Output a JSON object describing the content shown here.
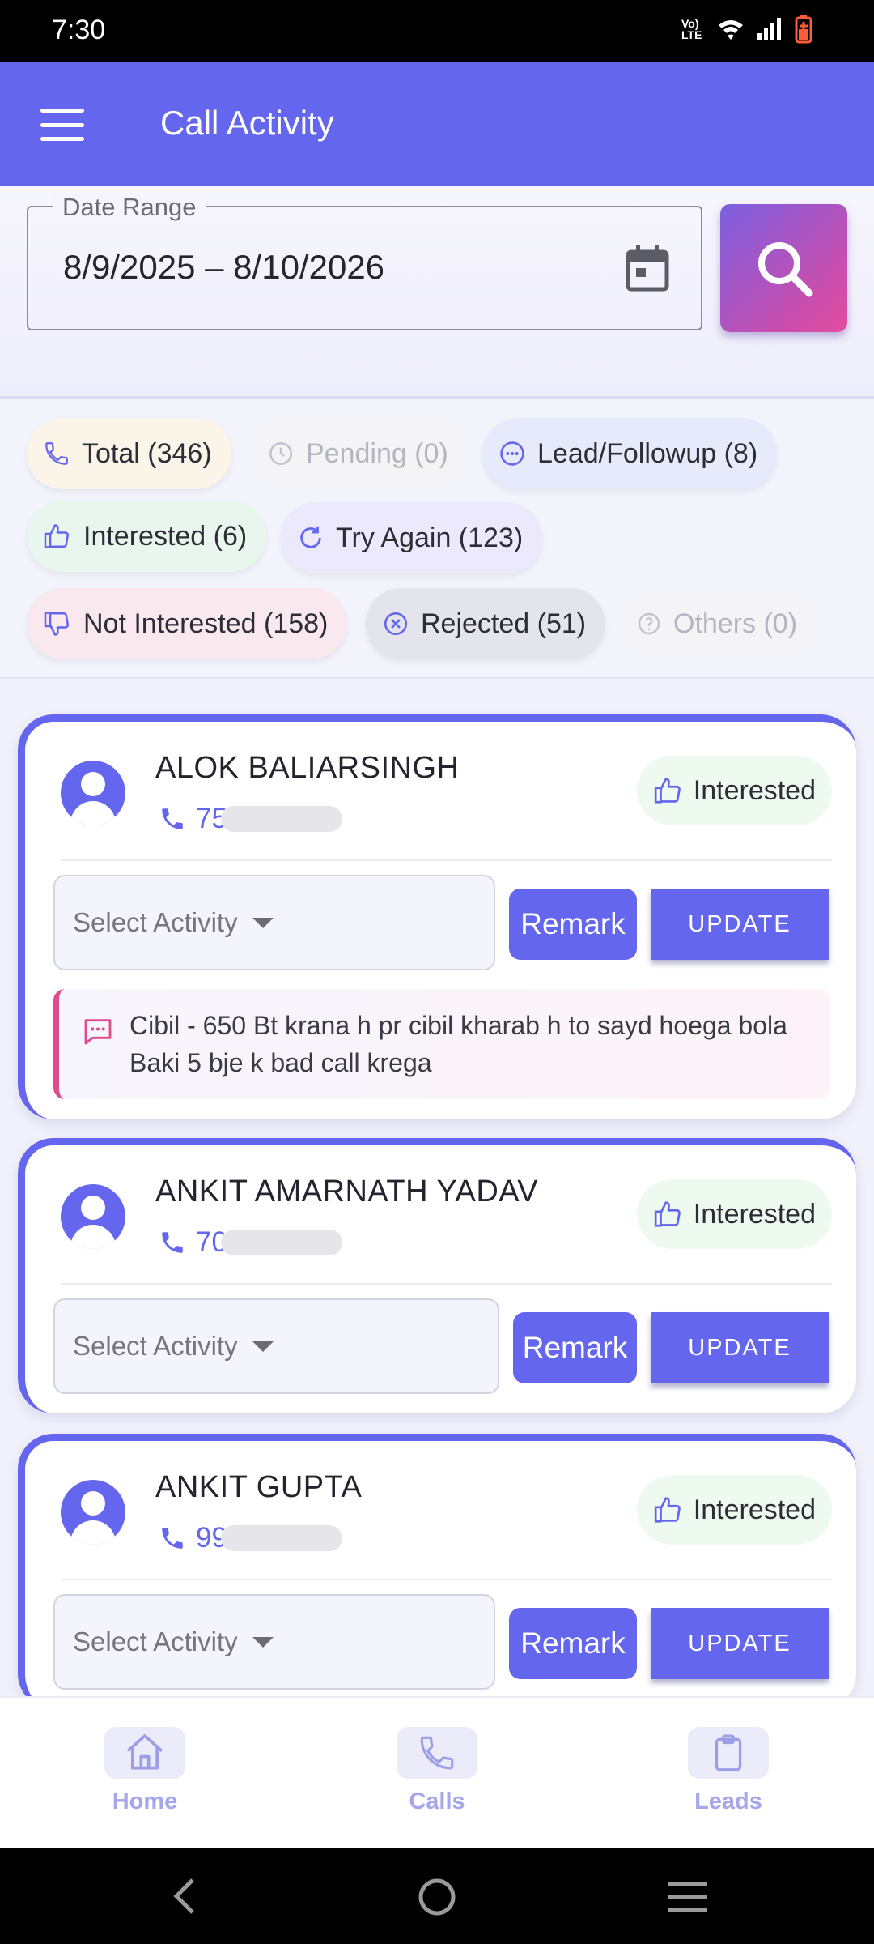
{
  "status_bar": {
    "time": "7:30",
    "network_label": "Vo) LTE"
  },
  "app_bar": {
    "title": "Call Activity"
  },
  "filter": {
    "date_label": "Date Range",
    "date_range": "8/9/2025  – 8/10/2026"
  },
  "chips": [
    {
      "label": "Total (346)",
      "icon": "phone-icon"
    },
    {
      "label": "Pending (0)",
      "icon": "clock-icon"
    },
    {
      "label": "Lead/Followup (8)",
      "icon": "chat-icon"
    },
    {
      "label": "Interested (6)",
      "icon": "thumbs-up-icon"
    },
    {
      "label": "Try Again (123)",
      "icon": "refresh-icon"
    },
    {
      "label": "Not Interested (158)",
      "icon": "thumbs-down-icon"
    },
    {
      "label": "Rejected (51)",
      "icon": "cancel-icon"
    },
    {
      "label": "Others (0)",
      "icon": "help-icon"
    }
  ],
  "cards": [
    {
      "name": "ALOK BALIARSINGH",
      "phone": "75",
      "status": "Interested",
      "select_placeholder": "Select Activity",
      "remark_btn": "Remark",
      "update_btn": "UPDATE",
      "remark": "Cibil - 650 Bt krana h pr cibil kharab h to sayd hoega bola Baki 5 bje k bad call krega"
    },
    {
      "name": "ANKIT AMARNATH YADAV",
      "phone": "70",
      "status": "Interested",
      "select_placeholder": "Select Activity",
      "remark_btn": "Remark",
      "update_btn": "UPDATE"
    },
    {
      "name": "ANKIT GUPTA",
      "phone": "99",
      "status": "Interested",
      "select_placeholder": "Select Activity",
      "remark_btn": "Remark",
      "update_btn": "UPDATE"
    }
  ],
  "bottom_nav": [
    {
      "label": "Home",
      "icon": "home-icon"
    },
    {
      "label": "Calls",
      "icon": "phone-icon"
    },
    {
      "label": "Leads",
      "icon": "clipboard-icon"
    }
  ],
  "colors": {
    "primary": "#6466ee",
    "accent_pink": "#e04a8f",
    "interested_bg": "#eefaef"
  }
}
